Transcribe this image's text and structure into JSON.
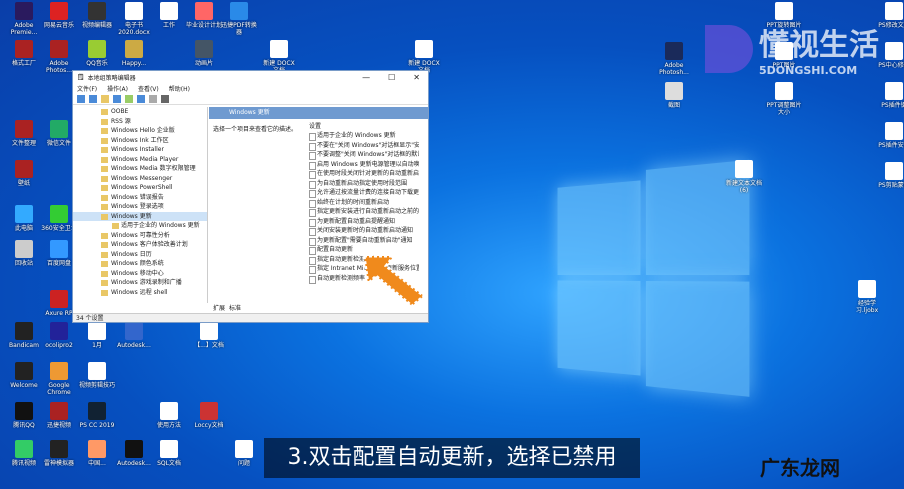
{
  "desktop_icons": [
    {
      "label": "Adobe Premie...",
      "color": "#2a1a5e"
    },
    {
      "label": "网易云音乐",
      "color": "#d22"
    },
    {
      "label": "视频编辑器",
      "color": "#333"
    },
    {
      "label": "电子书2020.docx",
      "color": "#fff"
    },
    {
      "label": "工作",
      "color": "#fff"
    },
    {
      "label": "毕业设计计划",
      "color": "#f66"
    },
    {
      "label": "迅捷PDF转换器",
      "color": "#2a8ae8"
    },
    {
      "label": "格式工厂",
      "color": "#a22"
    },
    {
      "label": "Adobe Photos...",
      "color": "#a22"
    },
    {
      "label": "QQ音乐",
      "color": "#9c3"
    },
    {
      "label": "Happy...",
      "color": "#ca4"
    },
    {
      "label": "动画片",
      "color": "#456"
    },
    {
      "label": "新建 DOCX 文档",
      "color": "#fff"
    },
    {
      "label": "新建 DOCX 文档",
      "color": "#fff"
    },
    {
      "label": "文件整理",
      "color": "#a22"
    },
    {
      "label": "微信文件",
      "color": "#2a6"
    },
    {
      "label": "此电脑",
      "color": "#3af"
    },
    {
      "label": "360安全卫士",
      "color": "#3c3"
    },
    {
      "label": "回收站",
      "color": "#ccc"
    },
    {
      "label": "百度网盘",
      "color": "#39f"
    },
    {
      "label": "壁纸",
      "color": "#a22"
    },
    {
      "label": "Axure RP",
      "color": "#c22"
    },
    {
      "label": "Bandicam",
      "color": "#222"
    },
    {
      "label": "ocolipro2",
      "color": "#229"
    },
    {
      "label": "1月",
      "color": "#fff"
    },
    {
      "label": "Autodesk...",
      "color": "#36c"
    },
    {
      "label": "【...】文档",
      "color": "#fff"
    },
    {
      "label": "Welcome",
      "color": "#222"
    },
    {
      "label": "Google Chrome",
      "color": "#e93"
    },
    {
      "label": "视频剪辑技巧",
      "color": "#fff"
    },
    {
      "label": "腾讯QQ",
      "color": "#111"
    },
    {
      "label": "迅捷视频",
      "color": "#a22"
    },
    {
      "label": "PS CC 2019",
      "color": "#123"
    },
    {
      "label": "使用方法",
      "color": "#fff"
    },
    {
      "label": "Loccy文档",
      "color": "#c33"
    },
    {
      "label": "腾讯视频",
      "color": "#3c6"
    },
    {
      "label": "雷神模拟器",
      "color": "#222"
    },
    {
      "label": "中国...",
      "color": "#f96"
    },
    {
      "label": "Autodesk...",
      "color": "#111"
    },
    {
      "label": "SQL文档",
      "color": "#fff"
    },
    {
      "label": "问题",
      "color": "#fff"
    },
    {
      "label": "Adobe Photosh...",
      "color": "#1a2a5a"
    },
    {
      "label": "截图",
      "color": "#ddd"
    },
    {
      "label": "PPT旋转图片",
      "color": "#fff"
    },
    {
      "label": "PPT图片",
      "color": "#fff"
    },
    {
      "label": "PPT调整图片大小",
      "color": "#fff"
    },
    {
      "label": "PS修改文字",
      "color": "#fff"
    },
    {
      "label": "PS中心修改",
      "color": "#fff"
    },
    {
      "label": "PS插件键",
      "color": "#fff"
    },
    {
      "label": "PS插件安装",
      "color": "#fff"
    },
    {
      "label": "PS剪贴蒙版",
      "color": "#fff"
    },
    {
      "label": "新建文本文档 (6)",
      "color": "#fff"
    },
    {
      "label": "经验学习.ljobx",
      "color": "#fff"
    }
  ],
  "window": {
    "title": "本地组策略编辑器",
    "controls": [
      "—",
      "☐",
      "✕"
    ],
    "menu": [
      "文件(F)",
      "操作(A)",
      "查看(V)",
      "帮助(H)"
    ],
    "tree": [
      "OOBE",
      "RSS 源",
      "Windows Hello 企业版",
      "Windows Ink 工作区",
      "Windows Installer",
      "Windows Media Player",
      "Windows Media 数字权限管理",
      "Windows Messenger",
      "Windows PowerShell",
      "Windows 错误报告",
      "Windows 登录选项",
      "Windows 更新",
      "适用于企业的 Windows 更新",
      "Windows 可靠性分析",
      "Windows 客户体验改善计划",
      "Windows 日历",
      "Windows 颜色系统",
      "Windows 移动中心",
      "Windows 游戏录制和广播",
      "Windows 远程 shell"
    ],
    "header": "Windows 更新",
    "description": "选择一个项目来查看它的描述。",
    "column": "设置",
    "settings": [
      "适用于企业的 Windows 更新",
      "不要在\"关闭 Windows\"对话框显示\"安装更新并关机\"",
      "不要调整\"关闭 Windows\"对话框的默认选项",
      "启用 Windows 更新电源管理以自动唤醒系统",
      "在使用时段关闭针对更新的自动重新启动",
      "为自动重新启动指定使用时段范围",
      "允许通过按流量计费的连接自动下载更新",
      "始终在计划的时间重新启动",
      "指定更新安装进行自动重新启动之前的期限",
      "为更新配置自动重启提醒通知",
      "关闭安装更新时的自动重新启动通知",
      "为更新配置\"需要自动重新启动\"通知",
      "配置自动更新",
      "指定自动更新检测频率",
      "指定 Intranet Microsoft 更新服务位置",
      "自动更新检测频率"
    ],
    "tabs": [
      "扩展",
      "标准"
    ],
    "status": "34 个设置"
  },
  "caption": "3.双击配置自动更新，选择已禁用",
  "watermarks": {
    "top": "懂视生活",
    "top_sub": "5DONGSHI.COM",
    "bottom": "广东龙网"
  }
}
